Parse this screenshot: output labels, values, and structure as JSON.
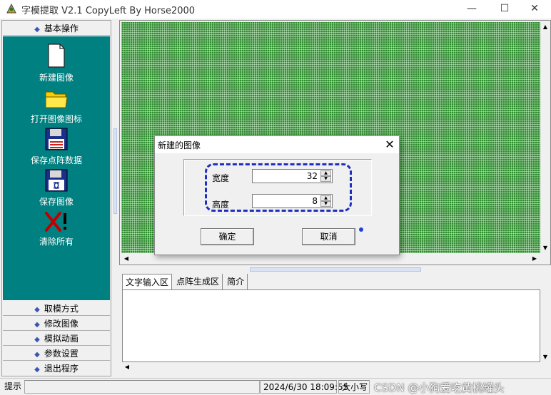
{
  "window": {
    "title": "字模提取 V2.1   CopyLeft By Horse2000",
    "controls": {
      "minimize": "—",
      "maximize": "☐",
      "close": "✕"
    }
  },
  "sidebar": {
    "active_section": "基本操作",
    "tools": [
      {
        "label": "新建图像",
        "icon": "new-file-icon"
      },
      {
        "label": "打开图像图标",
        "icon": "folder-open-icon"
      },
      {
        "label": "保存点阵数据",
        "icon": "floppy-save-data-icon"
      },
      {
        "label": "保存图像",
        "icon": "floppy-save-image-icon"
      },
      {
        "label": "清除所有",
        "icon": "clear-all-icon"
      }
    ],
    "sections": [
      "取模方式",
      "修改图像",
      "模拟动画",
      "参数设置",
      "退出程序"
    ]
  },
  "tabs": [
    "文字输入区",
    "点阵生成区",
    "简介"
  ],
  "dialog": {
    "title": "新建的图像",
    "width_label": "宽度",
    "width_value": "32",
    "height_label": "高度",
    "height_value": "8",
    "ok_label": "确定",
    "cancel_label": "取消",
    "close_glyph": "✕"
  },
  "statusbar": {
    "hint": "提示",
    "message": "",
    "datetime": "2024/6/30 18:09:55",
    "caps": "大小写"
  },
  "watermark": "CSDN @小狗爱吃黄桃罐头",
  "colors": {
    "sidebar_panel": "#008080",
    "canvas": "#2e8b2e",
    "highlight": "#1e2fc0"
  }
}
